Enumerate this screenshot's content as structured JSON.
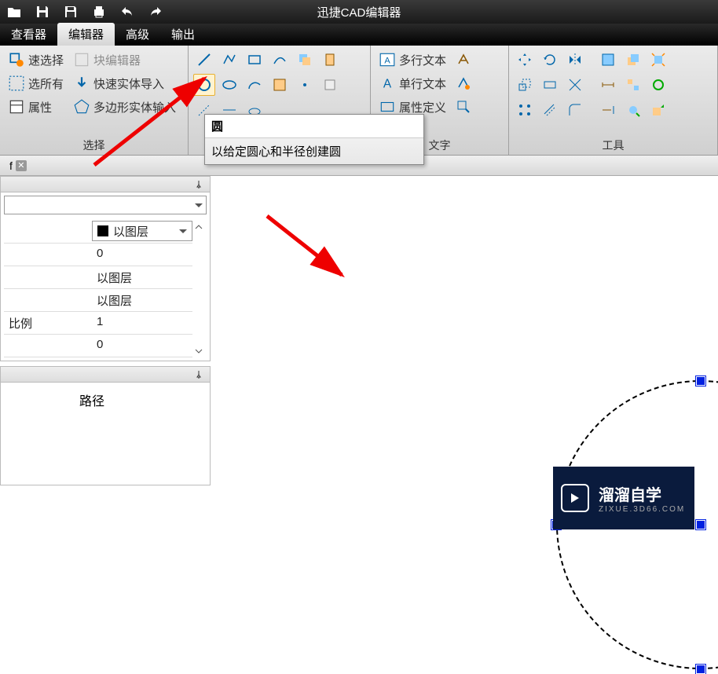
{
  "app": {
    "title": "迅捷CAD编辑器"
  },
  "tabs": {
    "viewer": "查看器",
    "editor": "编辑器",
    "advanced": "高级",
    "output": "输出"
  },
  "ribbon": {
    "select_group": {
      "quick_select": "速选择",
      "select_all": "选所有",
      "properties": "属性",
      "block_editor": "块编辑器",
      "quick_import": "快速实体导入",
      "polygon_input": "多边形实体输入",
      "label": "选择"
    },
    "text_group": {
      "multiline": "多行文本",
      "singleline": "单行文本",
      "attribute": "属性定义",
      "label": "文字"
    },
    "tools_group": {
      "label": "工具"
    }
  },
  "tooltip": {
    "title": "圆",
    "description": "以给定圆心和半径创建圆"
  },
  "props": {
    "label_scale": "比例",
    "layer_label": "以图层",
    "row1": "0",
    "row2": "以图层",
    "row3": "以图层",
    "row4": "1",
    "row5": "0"
  },
  "tree": {
    "root": "路径"
  },
  "watermark": {
    "main": "溜溜自学",
    "sub": "ZIXUE.3D66.COM"
  }
}
